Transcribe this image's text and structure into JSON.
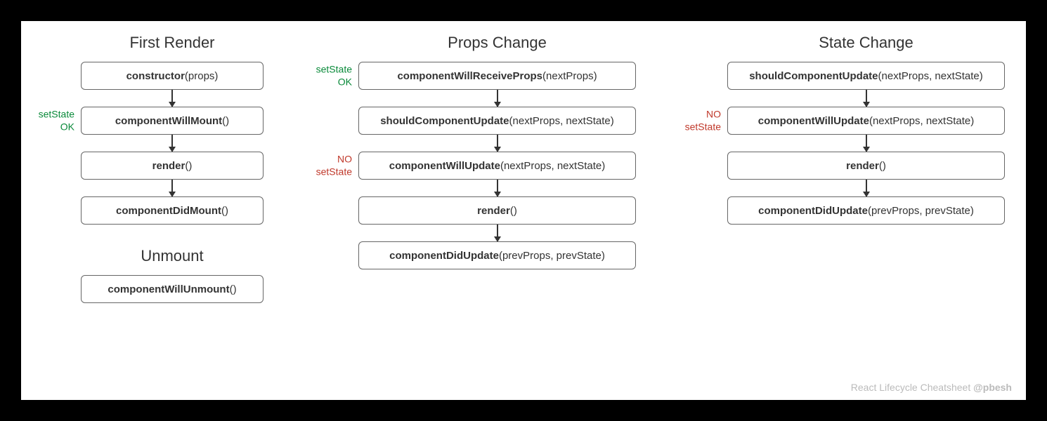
{
  "columns": {
    "firstRender": {
      "title": "First Render",
      "nodes": [
        {
          "bold": "constructor",
          "args": "(props)",
          "annot": null
        },
        {
          "bold": "componentWillMount",
          "args": "()",
          "annot": {
            "l1": "setState",
            "l2": "OK",
            "cls": "green"
          }
        },
        {
          "bold": "render",
          "args": "()",
          "annot": null
        },
        {
          "bold": "componentDidMount",
          "args": "()",
          "annot": null
        }
      ]
    },
    "unmount": {
      "title": "Unmount",
      "nodes": [
        {
          "bold": "componentWillUnmount",
          "args": "()",
          "annot": null
        }
      ]
    },
    "propsChange": {
      "title": "Props Change",
      "nodes": [
        {
          "bold": "componentWillReceiveProps",
          "args": "(nextProps)",
          "annot": {
            "l1": "setState",
            "l2": "OK",
            "cls": "green"
          }
        },
        {
          "bold": "shouldComponentUpdate",
          "args": "(nextProps, nextState)",
          "annot": null
        },
        {
          "bold": "componentWillUpdate",
          "args": "(nextProps, nextState)",
          "annot": {
            "l1": "NO",
            "l2": "setState",
            "cls": "red"
          }
        },
        {
          "bold": "render",
          "args": "()",
          "annot": null
        },
        {
          "bold": "componentDidUpdate",
          "args": "(prevProps, prevState)",
          "annot": null
        }
      ]
    },
    "stateChange": {
      "title": "State Change",
      "nodes": [
        {
          "bold": "shouldComponentUpdate",
          "args": "(nextProps, nextState)",
          "annot": null
        },
        {
          "bold": "componentWillUpdate",
          "args": "(nextProps, nextState)",
          "annot": {
            "l1": "NO",
            "l2": "setState",
            "cls": "red"
          }
        },
        {
          "bold": "render",
          "args": "()",
          "annot": null
        },
        {
          "bold": "componentDidUpdate",
          "args": "(prevProps, prevState)",
          "annot": null
        }
      ]
    }
  },
  "footer": {
    "text": "React Lifecycle Cheatsheet ",
    "handle": "@pbesh"
  }
}
